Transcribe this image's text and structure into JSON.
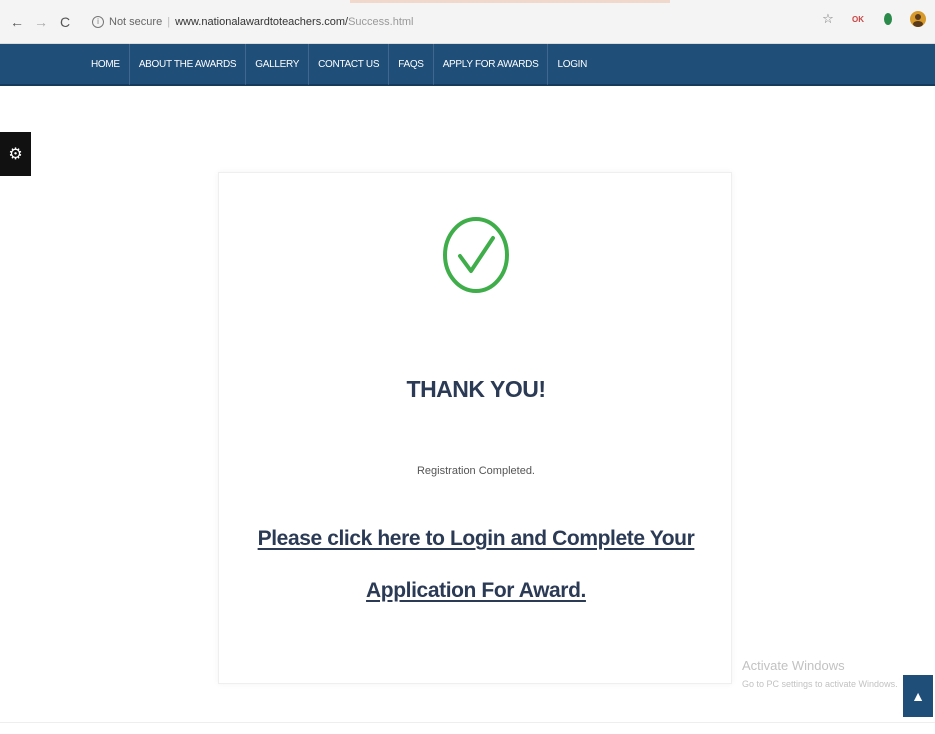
{
  "browser": {
    "security_label": "Not secure",
    "url_host": "www.nationalawardtoteachers.com/",
    "url_path": "Success.html",
    "back_glyph": "←",
    "forward_glyph": "→",
    "reload_glyph": "C",
    "star_glyph": "☆",
    "ext_ok_label": "OK"
  },
  "nav": {
    "items": [
      {
        "label": "HOME"
      },
      {
        "label": "ABOUT THE AWARDS"
      },
      {
        "label": "GALLERY"
      },
      {
        "label": "CONTACT US"
      },
      {
        "label": "FAQS"
      },
      {
        "label": "APPLY FOR AWARDS"
      },
      {
        "label": "LOGIN"
      }
    ],
    "bg_color": "#1f4e79"
  },
  "settings": {
    "icon": "gear-icon",
    "glyph": "⚙"
  },
  "success": {
    "icon": "check-circle-icon",
    "icon_color": "#3fae4a",
    "heading": "THANK YOU!",
    "status": "Registration Completed.",
    "link_line1": "Please click here to Login and Complete Your",
    "link_line2": "Application For Award."
  },
  "watermark": {
    "title": "Activate Windows",
    "subtitle": "Go to PC settings to activate Windows."
  },
  "back_to_top": {
    "icon": "chevron-up-icon",
    "glyph": "▲"
  }
}
